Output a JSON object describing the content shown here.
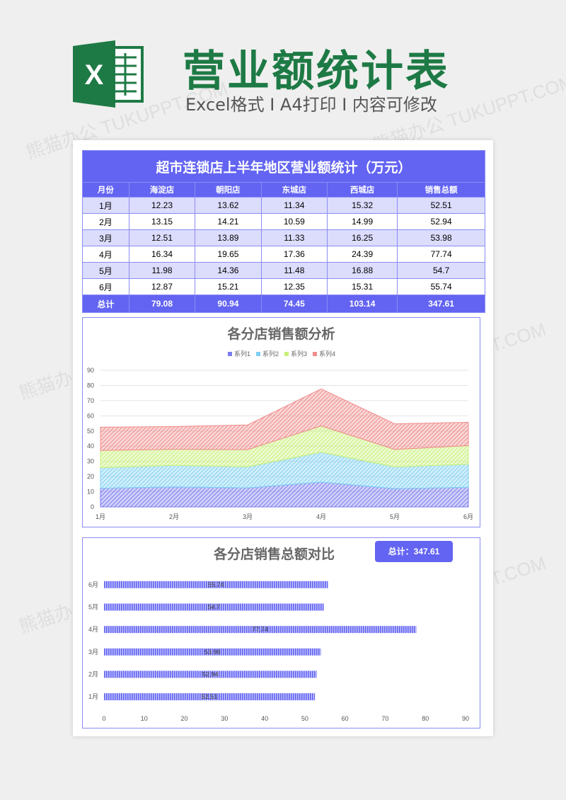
{
  "header": {
    "title": "营业额统计表",
    "subtitle": "Excel格式 I A4打印 I 内容可修改",
    "logo_letter": "X",
    "brand_color": "#1e7a45",
    "watermark": "熊猫办公 TUKUPPT.COM"
  },
  "table": {
    "caption": "超市连锁店上半年地区营业额统计（万元）",
    "columns": [
      "月份",
      "海淀店",
      "朝阳店",
      "东城店",
      "西城店",
      "销售总额"
    ],
    "rows": [
      [
        "1月",
        "12.23",
        "13.62",
        "11.34",
        "15.32",
        "52.51"
      ],
      [
        "2月",
        "13.15",
        "14.21",
        "10.59",
        "14.99",
        "52.94"
      ],
      [
        "3月",
        "12.51",
        "13.89",
        "11.33",
        "16.25",
        "53.98"
      ],
      [
        "4月",
        "16.34",
        "19.65",
        "17.36",
        "24.39",
        "77.74"
      ],
      [
        "5月",
        "11.98",
        "14.36",
        "11.48",
        "16.88",
        "54.7"
      ],
      [
        "6月",
        "12.87",
        "15.21",
        "12.35",
        "15.31",
        "55.74"
      ]
    ],
    "total": [
      "总计",
      "79.08",
      "90.94",
      "74.45",
      "103.14",
      "347.61"
    ],
    "accent": "#6364f2"
  },
  "chart_data": [
    {
      "type": "area",
      "stacked": true,
      "title": "各分店销售额分析",
      "categories": [
        "1月",
        "2月",
        "3月",
        "4月",
        "5月",
        "6月"
      ],
      "series": [
        {
          "name": "系列1",
          "values": [
            12.23,
            13.15,
            12.51,
            16.34,
            11.98,
            12.87
          ],
          "color": "#7b7cf0"
        },
        {
          "name": "系列2",
          "values": [
            13.62,
            14.21,
            13.89,
            19.65,
            14.36,
            15.21
          ],
          "color": "#7fd0f2"
        },
        {
          "name": "系列3",
          "values": [
            11.34,
            10.59,
            11.33,
            17.36,
            11.48,
            12.35
          ],
          "color": "#c8f07a"
        },
        {
          "name": "系列4",
          "values": [
            15.32,
            14.99,
            16.25,
            24.39,
            16.88,
            15.31
          ],
          "color": "#f08c8c"
        }
      ],
      "ylim": [
        0,
        90
      ],
      "yticks": [
        0,
        10,
        20,
        30,
        40,
        50,
        60,
        70,
        80,
        90
      ],
      "legend": "top",
      "grid": true
    },
    {
      "type": "bar",
      "orientation": "horizontal",
      "title": "各分店销售总额对比",
      "badge": "总计：347.61",
      "categories": [
        "6月",
        "5月",
        "4月",
        "3月",
        "2月",
        "1月"
      ],
      "values": [
        55.74,
        54.7,
        77.74,
        53.98,
        52.94,
        52.51
      ],
      "labels": [
        "55.74",
        "54.7",
        "77.74",
        "53.98",
        "52.94",
        "52.51"
      ],
      "xlim": [
        0,
        90
      ],
      "xticks": [
        0,
        10,
        20,
        30,
        40,
        50,
        60,
        70,
        80,
        90
      ],
      "color": "#6364f2"
    }
  ]
}
